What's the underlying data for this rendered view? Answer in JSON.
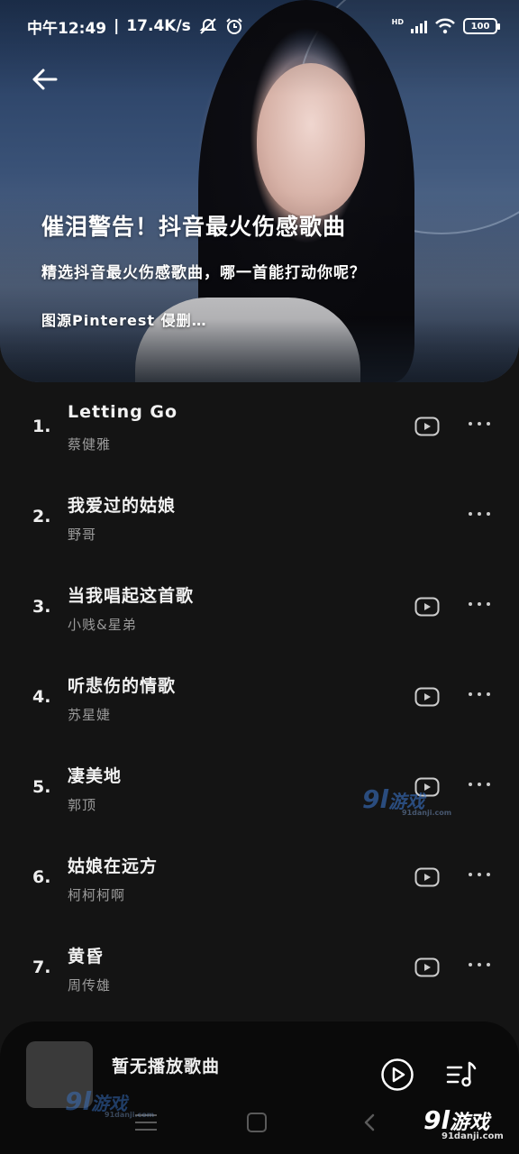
{
  "status_bar": {
    "time_label": "中午12:49",
    "network_speed": "17.4K/s",
    "battery_level": "100",
    "network_type": "HD"
  },
  "playlist": {
    "title": "催泪警告！抖音最火伤感歌曲",
    "subtitle": "精选抖音最火伤感歌曲，哪一首能打动你呢？",
    "credit": "图源Pinterest 侵删…"
  },
  "songs": [
    {
      "index": "1.",
      "title": "Letting Go",
      "artist": "蔡健雅",
      "has_mv": true
    },
    {
      "index": "2.",
      "title": "我爱过的姑娘",
      "artist": "野哥",
      "has_mv": false
    },
    {
      "index": "3.",
      "title": "当我唱起这首歌",
      "artist": "小贱&星弟",
      "has_mv": true
    },
    {
      "index": "4.",
      "title": "听悲伤的情歌",
      "artist": "苏星婕",
      "has_mv": true
    },
    {
      "index": "5.",
      "title": "凄美地",
      "artist": "郭顶",
      "has_mv": true
    },
    {
      "index": "6.",
      "title": "姑娘在远方",
      "artist": "柯柯柯啊",
      "has_mv": true
    },
    {
      "index": "7.",
      "title": "黄昏",
      "artist": "周传雄",
      "has_mv": true
    }
  ],
  "player": {
    "now_playing": "暂无播放歌曲"
  },
  "watermark": {
    "logo_number": "9l",
    "logo_text": "游戏",
    "logo_url": "91danji.com"
  },
  "icons": {
    "back": "arrow-left-icon",
    "mv": "video-play-icon",
    "more": "more-dots-icon",
    "play": "play-circle-icon",
    "queue": "music-list-icon"
  }
}
